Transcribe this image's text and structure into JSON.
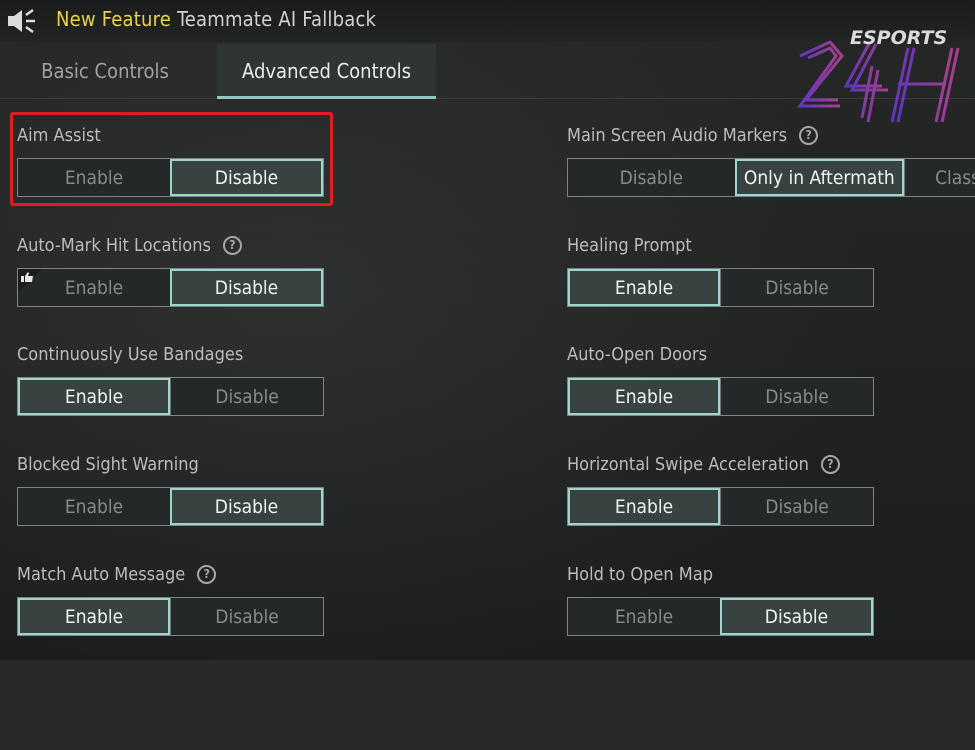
{
  "announcement": {
    "highlight": "New Feature",
    "text": "Teammate AI Fallback"
  },
  "tabs": [
    {
      "label": "Basic Controls",
      "active": false
    },
    {
      "label": "Advanced Controls",
      "active": true
    }
  ],
  "logo": {
    "text": "ESPORTS",
    "mark": "24H"
  },
  "left_settings": [
    {
      "label": "Aim Assist",
      "help": false,
      "options": [
        "Enable",
        "Disable"
      ],
      "selected": "Disable"
    },
    {
      "label": "Auto-Mark Hit Locations",
      "help": true,
      "options": [
        "Enable",
        "Disable"
      ],
      "selected": "Disable"
    },
    {
      "label": "Continuously Use Bandages",
      "help": false,
      "options": [
        "Enable",
        "Disable"
      ],
      "selected": "Enable"
    },
    {
      "label": "Blocked Sight Warning",
      "help": false,
      "options": [
        "Enable",
        "Disable"
      ],
      "selected": "Disable"
    },
    {
      "label": "Match Auto Message",
      "help": true,
      "options": [
        "Enable",
        "Disable"
      ],
      "selected": "Enable"
    }
  ],
  "right_settings": [
    {
      "label": "Main Screen Audio Markers",
      "help": true,
      "options": [
        "Disable",
        "Only in Aftermath",
        "Class"
      ],
      "selected": "Only in Aftermath"
    },
    {
      "label": "Healing Prompt",
      "help": false,
      "options": [
        "Enable",
        "Disable"
      ],
      "selected": "Enable"
    },
    {
      "label": "Auto-Open Doors",
      "help": false,
      "options": [
        "Enable",
        "Disable"
      ],
      "selected": "Enable"
    },
    {
      "label": "Horizontal Swipe Acceleration",
      "help": true,
      "options": [
        "Enable",
        "Disable"
      ],
      "selected": "Enable"
    },
    {
      "label": "Hold to Open Map",
      "help": false,
      "options": [
        "Enable",
        "Disable"
      ],
      "selected": "Disable"
    }
  ],
  "help_symbol": "?",
  "colors": {
    "accent": "#9fd4cf",
    "highlight_text": "#e8d24b",
    "annotation_box": "#e11d24"
  }
}
